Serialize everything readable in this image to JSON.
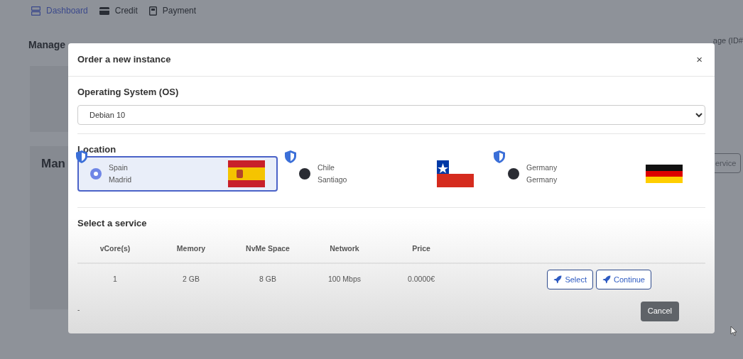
{
  "nav": [
    {
      "label": "Dashboard",
      "selected": true
    },
    {
      "label": "Credit",
      "selected": false
    },
    {
      "label": "Payment",
      "selected": false
    }
  ],
  "page": {
    "title": "Manage",
    "breadcrumb": "age (ID#",
    "card_title": "Man",
    "card_button": "ervice"
  },
  "modal": {
    "title": "Order a new instance",
    "close": "×",
    "os": {
      "label": "Operating System (OS)",
      "value": "Debian 10"
    },
    "location": {
      "label": "Location",
      "options": [
        {
          "country": "Spain",
          "city": "Madrid",
          "kind": "es",
          "selected": true
        },
        {
          "country": "Chile",
          "city": "Santiago",
          "kind": "cl",
          "selected": false
        },
        {
          "country": "Germany",
          "city": "Germany",
          "kind": "de",
          "selected": false
        }
      ]
    },
    "service": {
      "label": "Select a service",
      "columns": [
        "vCore(s)",
        "Memory",
        "NvMe Space",
        "Network",
        "Price"
      ],
      "rows": [
        {
          "cells": [
            "1",
            "2 GB",
            "8 GB",
            "100 Mbps",
            "0.0000€"
          ],
          "buttons": [
            "Select",
            "Continue"
          ]
        }
      ]
    },
    "footer_note": "-",
    "cancel": "Cancel"
  }
}
